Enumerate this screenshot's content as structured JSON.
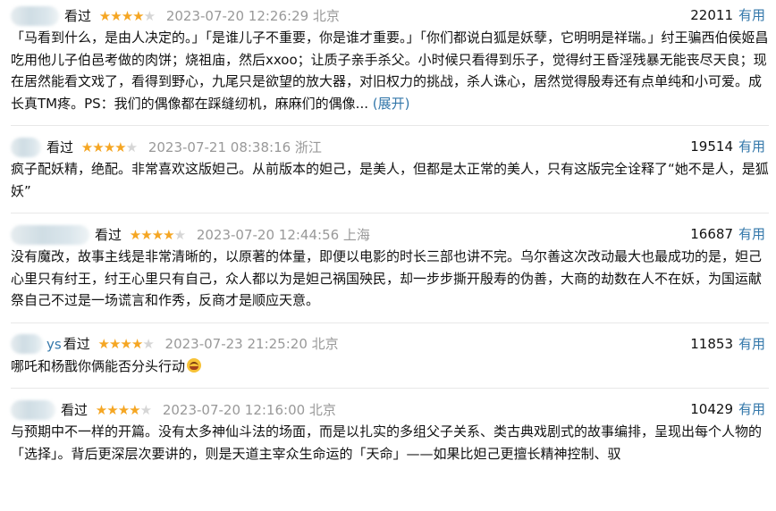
{
  "reviews": [
    {
      "user": "",
      "watched_label": "看过",
      "rating": 4,
      "time": "2023-07-20 12:26:29 北京",
      "votes": "22011",
      "useful_label": "有用",
      "content": "「马看到什么，是由人决定的。」「是谁儿子不重要，你是谁才重要。」「你们都说白狐是妖孽，它明明是祥瑞。」纣王骗西伯侯姬昌吃用他儿子伯邑考做的肉饼；烧祖庙，然后xxoo；让质子亲手杀父。小时候只看得到乐子，觉得纣王昏淫残暴无能丧尽天良；现在居然能看文戏了，看得到野心，九尾只是欲望的放大器，对旧权力的挑战，杀人诛心，居然觉得殷寿还有点单纯和小可爱。成长真TM疼。PS：我们的偶像都在踩缝纫机，麻麻们的偶像...",
      "expand_label": "(展开)"
    },
    {
      "user": "",
      "watched_label": "看过",
      "rating": 4,
      "time": "2023-07-21 08:38:16 浙江",
      "votes": "19514",
      "useful_label": "有用",
      "content": "疯子配妖精，绝配。非常喜欢这版妲己。从前版本的妲己，是美人，但都是太正常的美人，只有这版完全诠释了“她不是人，是狐妖”",
      "expand_label": ""
    },
    {
      "user": "",
      "watched_label": "看过",
      "rating": 4,
      "time": "2023-07-20 12:44:56 上海",
      "votes": "16687",
      "useful_label": "有用",
      "content": "没有魔改，故事主线是非常清晰的，以原著的体量，即便以电影的时长三部也讲不完。乌尔善这次改动最大也最成功的是，妲己心里只有纣王，纣王心里只有自己，众人都以为是妲己祸国殃民，却一步步撕开殷寿的伪善，大商的劫数在人不在妖，为国运献祭自己不过是一场谎言和作秀，反商才是顺应天意。",
      "expand_label": ""
    },
    {
      "user": "ys",
      "watched_label": "看过",
      "rating": 4,
      "time": "2023-07-23 21:25:20 北京",
      "votes": "11853",
      "useful_label": "有用",
      "content": "哪吒和杨戬你俩能否分头行动",
      "expand_label": ""
    },
    {
      "user": "",
      "watched_label": "看过",
      "rating": 4,
      "time": "2023-07-20 12:16:00 北京",
      "votes": "10429",
      "useful_label": "有用",
      "content": "与预期中不一样的开篇。没有太多神仙斗法的场面，而是以扎实的多组父子关系、类古典戏剧式的故事编排，呈现出每个人物的「选择」。背后更深层次要讲的，则是天道主宰众生命运的「天命」——如果比妲己更擅长精神控制、驭",
      "expand_label": ""
    }
  ]
}
